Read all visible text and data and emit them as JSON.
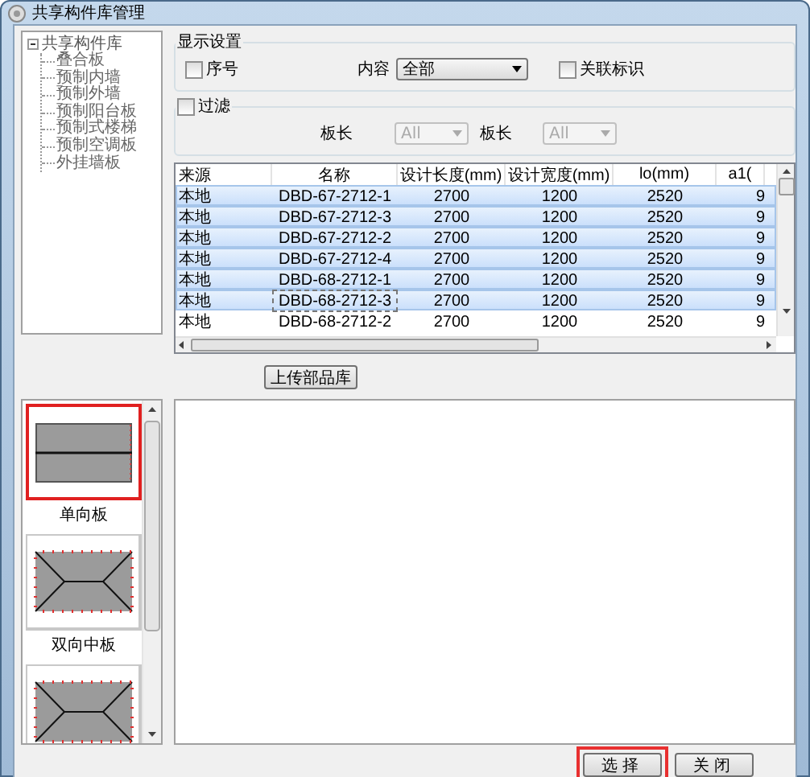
{
  "window": {
    "title": "共享构件库管理"
  },
  "tree": {
    "label": "共享构件库",
    "expanded": true,
    "children": [
      {
        "label": "叠合板"
      },
      {
        "label": "预制内墙"
      },
      {
        "label": "预制外墙"
      },
      {
        "label": "预制阳台板"
      },
      {
        "label": "预制式楼梯"
      },
      {
        "label": "预制空调板"
      },
      {
        "label": "外挂墙板"
      }
    ]
  },
  "display_settings": {
    "title": "显示设置",
    "serial": {
      "label": "序号",
      "checked": false
    },
    "content": {
      "label": "内容",
      "value": "全部"
    },
    "link_mark": {
      "label": "关联标识",
      "checked": false
    }
  },
  "filter": {
    "label": "过滤",
    "checked": false,
    "fields": [
      {
        "label": "板长",
        "value": "All",
        "disabled": true
      },
      {
        "label": "板长",
        "value": "All",
        "disabled": true
      }
    ]
  },
  "table": {
    "columns": [
      "来源",
      "名称",
      "设计长度(mm)",
      "设计宽度(mm)",
      "lo(mm)",
      "a1("
    ],
    "rows": [
      {
        "cells": [
          "本地",
          "DBD-67-2712-1",
          "2700",
          "1200",
          "2520",
          "9"
        ],
        "selected": true,
        "focused": false
      },
      {
        "cells": [
          "本地",
          "DBD-67-2712-3",
          "2700",
          "1200",
          "2520",
          "9"
        ],
        "selected": true,
        "focused": false
      },
      {
        "cells": [
          "本地",
          "DBD-67-2712-2",
          "2700",
          "1200",
          "2520",
          "9"
        ],
        "selected": true,
        "focused": false
      },
      {
        "cells": [
          "本地",
          "DBD-67-2712-4",
          "2700",
          "1200",
          "2520",
          "9"
        ],
        "selected": true,
        "focused": false
      },
      {
        "cells": [
          "本地",
          "DBD-68-2712-1",
          "2700",
          "1200",
          "2520",
          "9"
        ],
        "selected": true,
        "focused": false
      },
      {
        "cells": [
          "本地",
          "DBD-68-2712-3",
          "2700",
          "1200",
          "2520",
          "9"
        ],
        "selected": true,
        "focused": true
      },
      {
        "cells": [
          "本地",
          "DBD-68-2712-2",
          "2700",
          "1200",
          "2520",
          "9"
        ],
        "selected": false,
        "focused": false
      }
    ]
  },
  "upload_button": "上传部品库",
  "thumbnails": [
    {
      "kind": "one-way",
      "caption": "单向板",
      "selected": true
    },
    {
      "kind": "two-way",
      "caption": "双向中板",
      "selected": false
    },
    {
      "kind": "two-way",
      "selected": false
    }
  ],
  "buttons": [
    {
      "label": "选择",
      "highlighted": true
    },
    {
      "label": "关闭",
      "highlighted": false
    }
  ]
}
